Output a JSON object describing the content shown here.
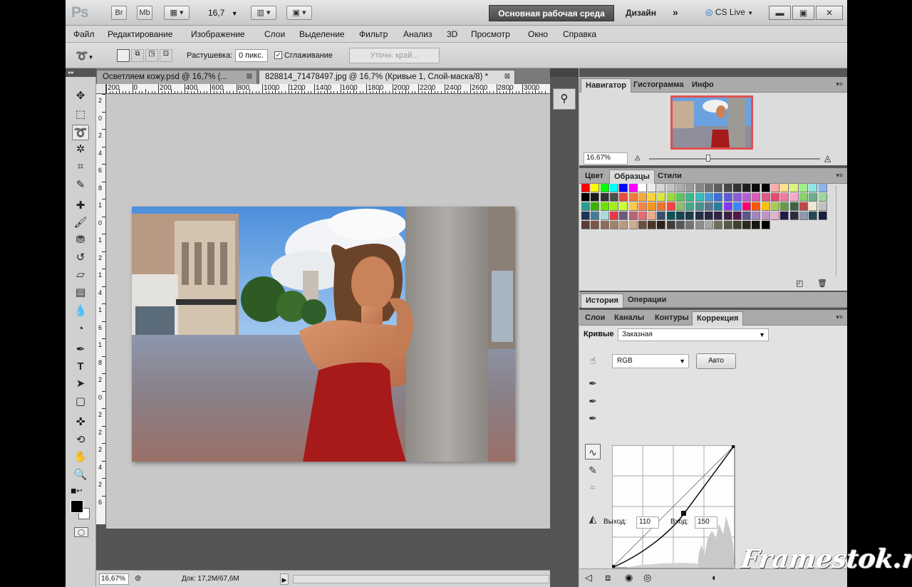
{
  "appbar": {
    "ps_logo": "Ps",
    "bridge_btn": "Br",
    "minibridge_btn": "Mb",
    "zoom_value": "16,7",
    "workspace_label": "Основная рабочая среда",
    "design_label": "Дизайн",
    "more_label": "»",
    "cs_live_label": "CS Live"
  },
  "menu": {
    "items": [
      "Файл",
      "Редактирование",
      "Изображение",
      "Слои",
      "Выделение",
      "Фильтр",
      "Анализ",
      "3D",
      "Просмотр",
      "Окно",
      "Справка"
    ]
  },
  "options": {
    "feather_label": "Растушевка:",
    "feather_value": "0 пикс.",
    "antialias_label": "Сглаживание",
    "antialias_checked": true,
    "refine_edge_label": "Уточн. край..."
  },
  "doc_tabs": [
    {
      "label": "Осветляем кожу.psd @ 16,7% (...",
      "active": false
    },
    {
      "label": "828814_71478497.jpg @ 16,7% (Кривые 1, Слой-маска/8) *",
      "active": true
    }
  ],
  "ruler": {
    "h_ticks": [
      "200",
      "0",
      "200",
      "400",
      "600",
      "800",
      "1000",
      "1200",
      "1400",
      "1600",
      "1800",
      "2000",
      "2200",
      "2400",
      "2600",
      "2800",
      "3000"
    ],
    "v_ticks": [
      "2",
      "0",
      "2",
      "4",
      "6",
      "8",
      "1",
      "0",
      "1",
      "2",
      "1",
      "4",
      "1",
      "6",
      "1",
      "8",
      "2",
      "0",
      "2",
      "2",
      "2",
      "4",
      "2",
      "6"
    ]
  },
  "status": {
    "zoom": "16,67%",
    "doc_info": "Док: 17,2M/67,6M"
  },
  "navigator": {
    "tabs": [
      "Навигатор",
      "Гистограмма",
      "Инфо"
    ],
    "zoom": "16.67%"
  },
  "swatches_panel": {
    "tabs": [
      "Цвет",
      "Образцы",
      "Стили"
    ]
  },
  "history_panel": {
    "tabs": [
      "История",
      "Операции"
    ]
  },
  "adjust_panel": {
    "tabs": [
      "Слои",
      "Каналы",
      "Контуры",
      "Коррекция"
    ],
    "curves_label": "Кривые",
    "preset_value": "Заказная",
    "channel_value": "RGB",
    "auto_label": "Авто",
    "output_label": "Выход:",
    "output_value": "110",
    "input_label": "Вход:",
    "input_value": "150"
  },
  "watermark": "Framestok.ru",
  "colors": {
    "workspace_btn": "#555555",
    "panel_bg": "#dcdcdc",
    "nav_frame": "#e05050"
  }
}
